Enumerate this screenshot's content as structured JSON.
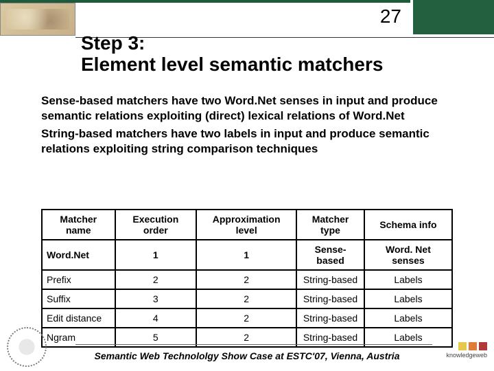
{
  "page_number": "27",
  "title_line1": "Step 3:",
  "title_line2": "Element level semantic matchers",
  "para": {
    "sense_lead": "Sense-based matchers",
    "sense_rest": " have two Word.Net senses in input and produce semantic relations exploiting (direct) lexical relations of Word.Net",
    "string_lead": "String-based matchers",
    "string_rest": " have two labels in input and produce semantic relations exploiting string comparison techniques"
  },
  "table": {
    "headers": [
      "Matcher name",
      "Execution order",
      "Approximation level",
      "Matcher type",
      "Schema info"
    ],
    "rows": [
      [
        "Word.Net",
        "1",
        "1",
        "Sense-based",
        "Word. Net senses"
      ],
      [
        "Prefix",
        "2",
        "2",
        "String-based",
        "Labels"
      ],
      [
        "Suffix",
        "3",
        "2",
        "String-based",
        "Labels"
      ],
      [
        "Edit distance",
        "4",
        "2",
        "String-based",
        "Labels"
      ],
      [
        "Ngram",
        "5",
        "2",
        "String-based",
        "Labels"
      ]
    ]
  },
  "footer": "Semantic Web Technololgy Show Case at ESTC'07, Vienna, Austria",
  "kw_label": "knowledgeweb"
}
